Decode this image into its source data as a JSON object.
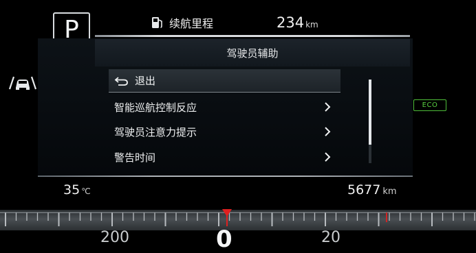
{
  "gear": "P",
  "range": {
    "label": "续航里程",
    "value": "234",
    "unit": "km"
  },
  "panel": {
    "title": "驾驶员辅助",
    "items": [
      {
        "label": "退出",
        "type": "back",
        "selected": true
      },
      {
        "label": "智能巡航控制反应",
        "type": "submenu"
      },
      {
        "label": "驾驶员注意力提示",
        "type": "submenu"
      },
      {
        "label": "警告时间",
        "type": "submenu"
      }
    ],
    "scroll_position": 0.78
  },
  "eco_badge": "ECO",
  "temperature": {
    "value": "35",
    "unit": "℃"
  },
  "odometer": {
    "value": "5677",
    "unit": "km"
  },
  "gauge": {
    "left_number": "200",
    "center_number": "0",
    "right_number": "20"
  },
  "colors": {
    "eco_green": "#58d040",
    "needle_red": "#e02020",
    "accent_white": "#e8eaec"
  },
  "icons": {
    "fuel": "fuel-pump-icon",
    "back": "back-arrow-icon",
    "chevron": "chevron-right-icon",
    "adas": "lane-assist-car-icon"
  }
}
